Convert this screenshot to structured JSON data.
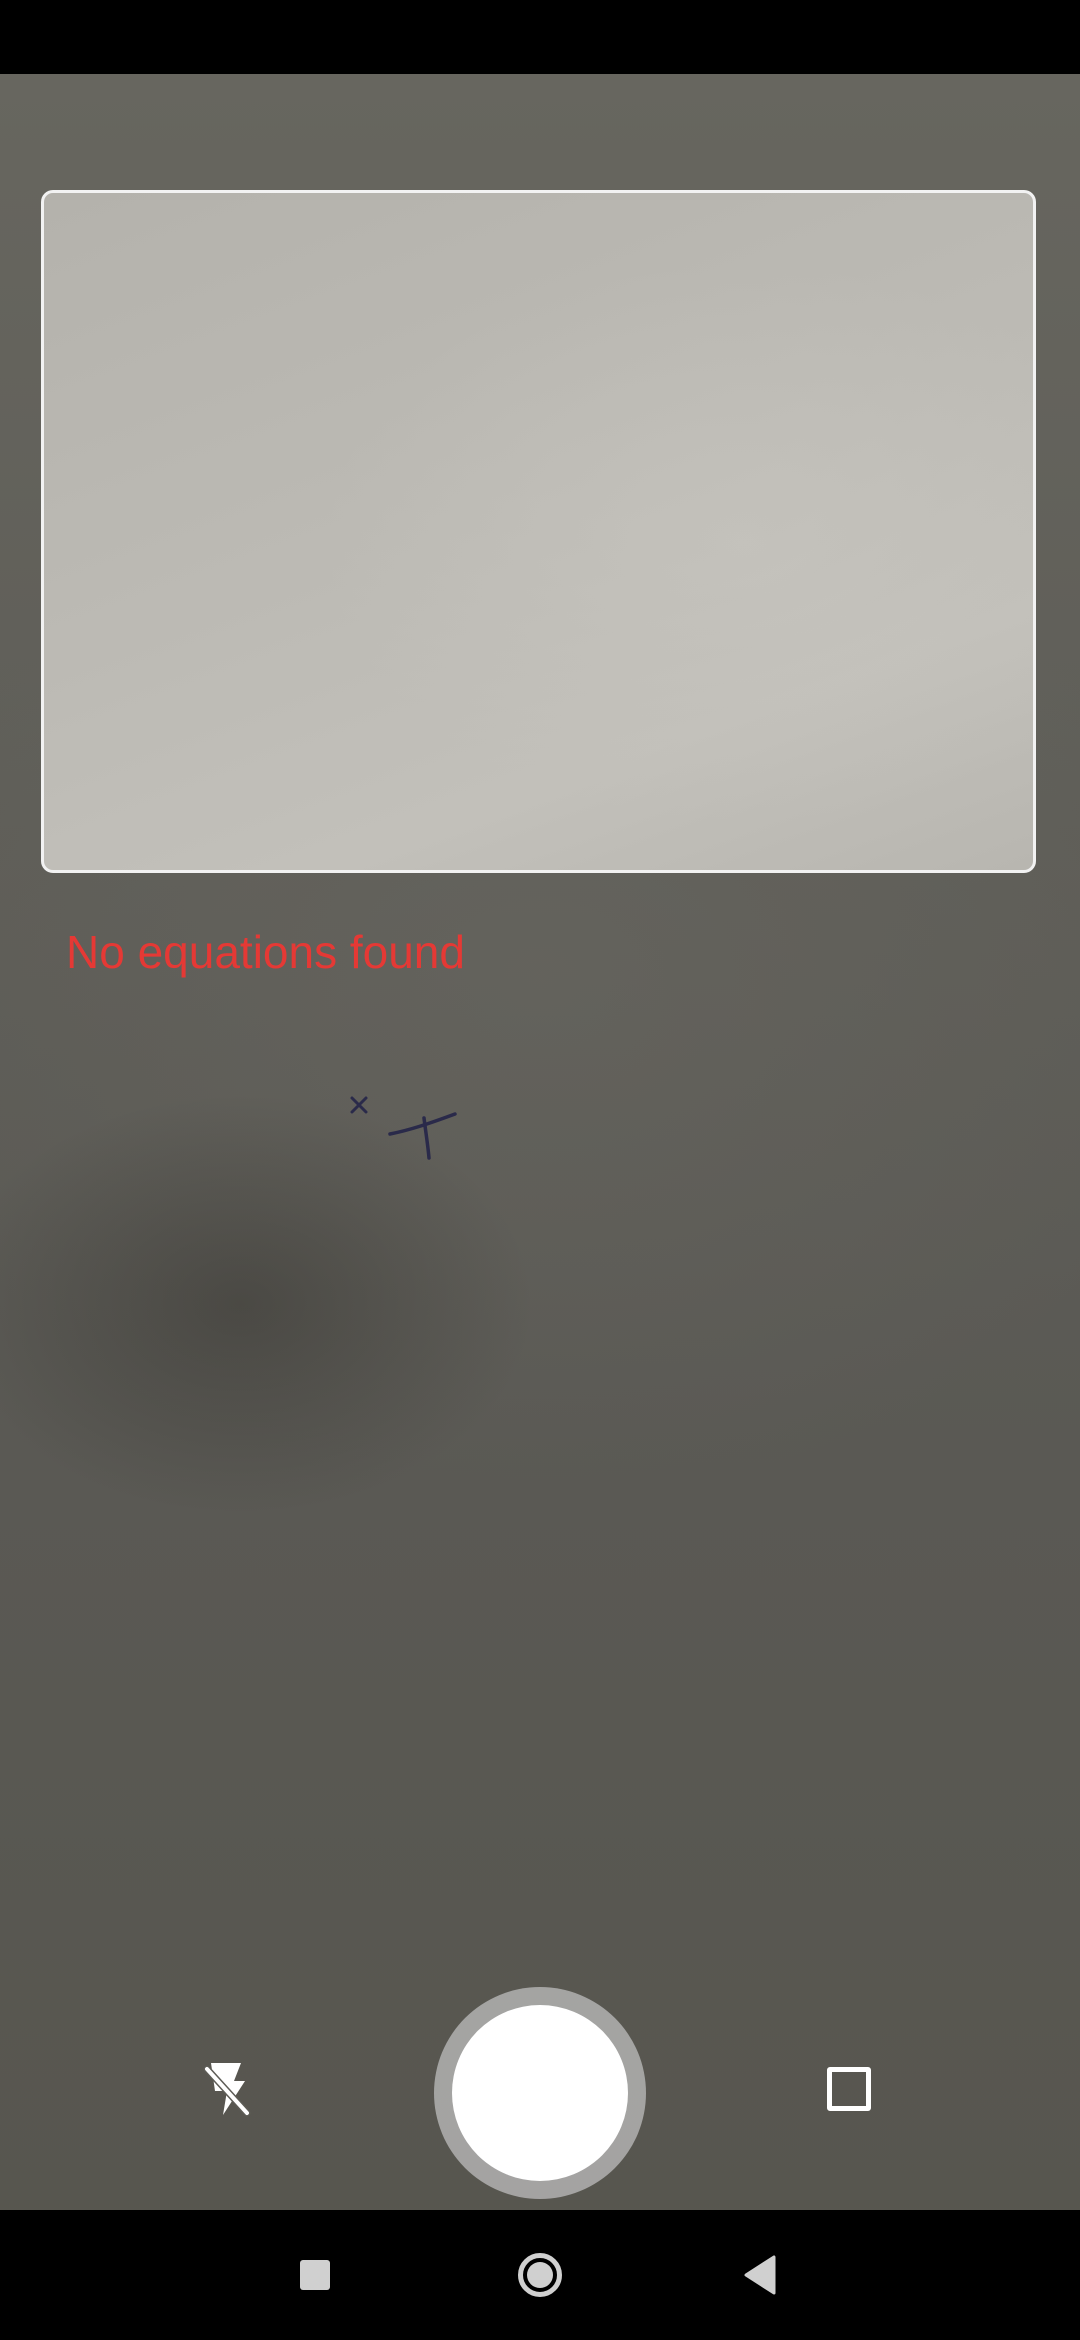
{
  "app": {
    "screen": "equation-scanner-camera"
  },
  "scan": {
    "status_message": "No equations found",
    "status_color": "#e53935",
    "frame_border_color": "#f2f2f2"
  },
  "controls": {
    "flash_icon": "flash-off-icon",
    "shutter_icon": "shutter-button",
    "crop_icon": "crop-square-icon"
  },
  "navigation": {
    "recent_icon": "recent-apps-icon",
    "home_icon": "home-icon",
    "back_icon": "back-icon"
  }
}
